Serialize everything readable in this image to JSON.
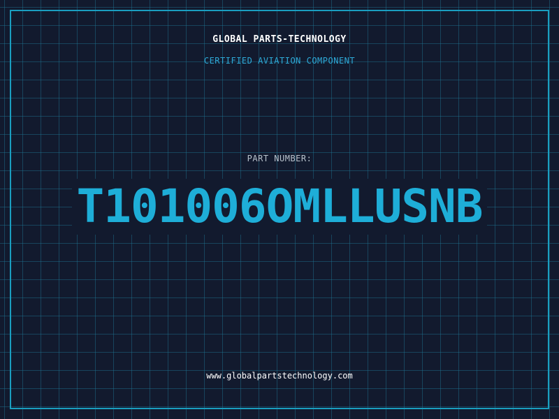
{
  "header": {
    "company": "GLOBAL PARTS-TECHNOLOGY",
    "tagline": "CERTIFIED AVIATION COMPONENT"
  },
  "part": {
    "label": "PART NUMBER:",
    "number": "T101006OMLLUSNB"
  },
  "footer": {
    "website": "www.globalpartstechnology.com"
  },
  "colors": {
    "background": "#121a2e",
    "grid": "#1e7896",
    "frame": "#1a9ec0",
    "accent": "#1eaed8",
    "label": "#b8c2cc",
    "text": "#ffffff"
  }
}
